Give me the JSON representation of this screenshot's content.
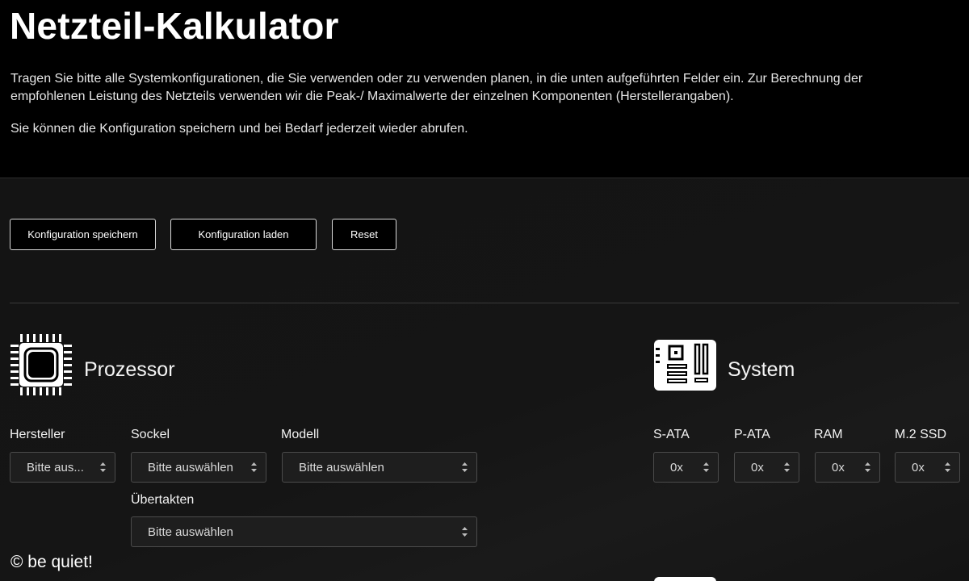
{
  "header": {
    "title": "Netzteil-Kalkulator",
    "intro1": "Tragen Sie bitte alle Systemkonfigurationen, die Sie verwenden oder zu verwenden planen, in die unten aufgeführten Felder ein. Zur Berechnung der empfohlenen Leistung des Netzteils verwenden wir die Peak-/ Maximalwerte der einzelnen Komponenten (Herstellerangaben).",
    "intro2": "Sie können die Konfiguration speichern und bei Bedarf jederzeit wieder abrufen."
  },
  "toolbar": {
    "save": "Konfiguration speichern",
    "load": "Konfiguration laden",
    "reset": "Reset"
  },
  "processor": {
    "title": "Prozessor",
    "icon": "cpu-chip-icon",
    "manufacturer": {
      "label": "Hersteller",
      "value": "Bitte aus..."
    },
    "socket": {
      "label": "Sockel",
      "value": "Bitte auswählen"
    },
    "model": {
      "label": "Modell",
      "value": "Bitte auswählen"
    },
    "overclock": {
      "label": "Übertakten",
      "value": "Bitte auswählen"
    }
  },
  "system": {
    "title": "System",
    "icon": "motherboard-icon",
    "sata": {
      "label": "S-ATA",
      "value": "0x"
    },
    "pata": {
      "label": "P-ATA",
      "value": "0x"
    },
    "ram": {
      "label": "RAM",
      "value": "0x"
    },
    "m2": {
      "label": "M.2 SSD",
      "value": "0x"
    }
  },
  "footer": {
    "copyright": "© be quiet!"
  },
  "colors": {
    "background": "#131313",
    "header_bg": "#000000",
    "text": "#ffffff",
    "field_bg": "#1e1e1e"
  }
}
